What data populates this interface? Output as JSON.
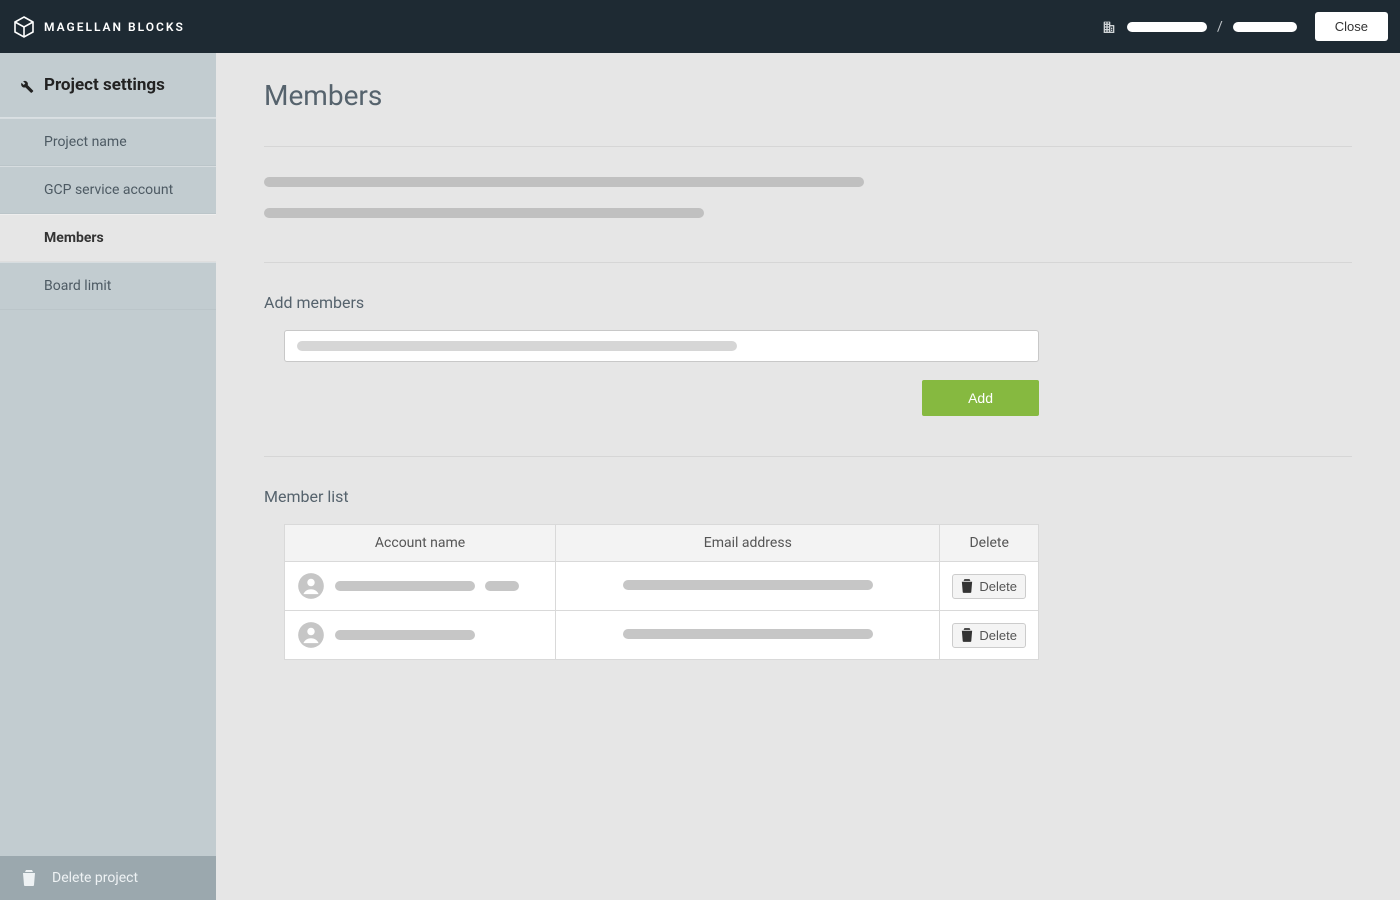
{
  "app": {
    "brand": "MAGELLAN BLOCKS"
  },
  "topbar": {
    "breadcrumb_separator": "/",
    "close_label": "Close"
  },
  "sidebar": {
    "title": "Project settings",
    "nav": {
      "project_name": "Project name",
      "gcp_service_account": "GCP service account",
      "members": "Members",
      "board_limit": "Board limit"
    },
    "delete_project_label": "Delete project"
  },
  "page": {
    "title": "Members",
    "add_members": {
      "label": "Add members",
      "button": "Add"
    },
    "member_list": {
      "label": "Member list",
      "headers": {
        "account": "Account name",
        "email": "Email address",
        "delete": "Delete"
      },
      "row_delete_label": "Delete"
    }
  }
}
